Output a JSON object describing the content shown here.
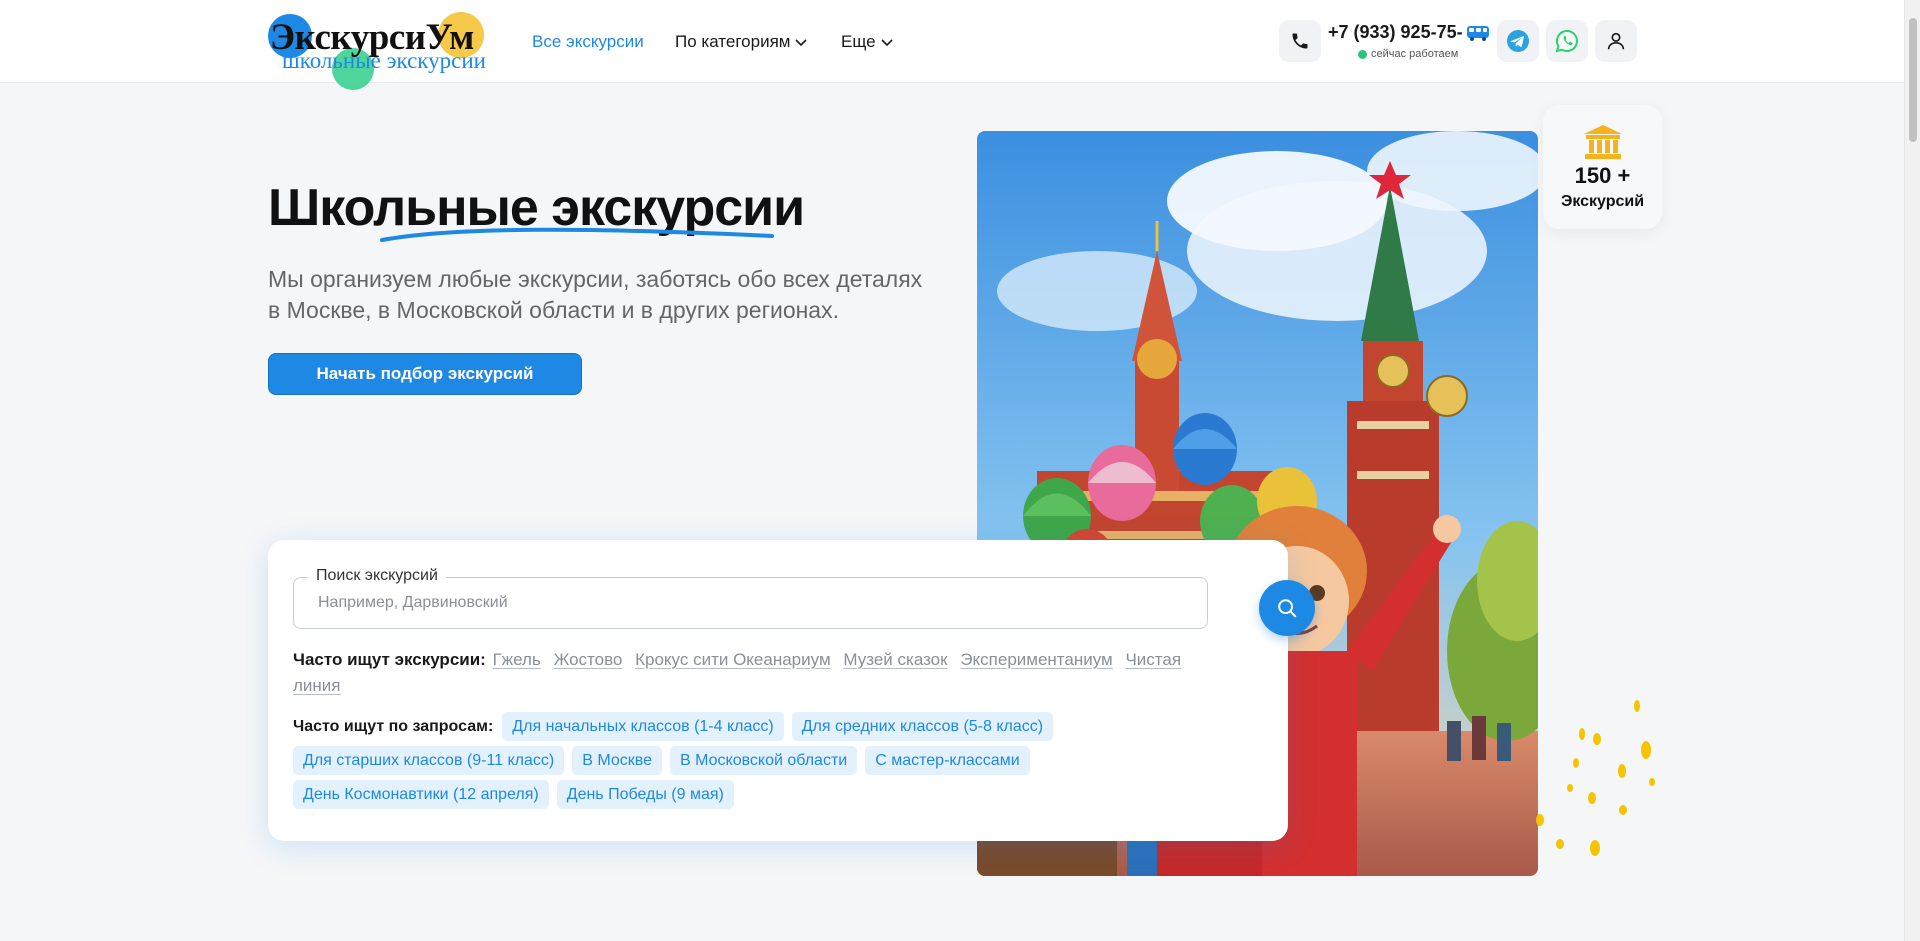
{
  "header": {
    "logo": {
      "title": "ЭкскурсиУм",
      "subtitle": "школьные экскурсии"
    },
    "nav": [
      {
        "label": "Все экскурсии",
        "active": true,
        "dropdown": false
      },
      {
        "label": "По категориям",
        "active": false,
        "dropdown": true
      },
      {
        "label": "Еще",
        "active": false,
        "dropdown": true
      }
    ],
    "phone": {
      "number": "+7 (933) 925-75-",
      "status": "сейчас работаем",
      "status_color": "#2ec27e"
    },
    "icons": [
      "phone-icon",
      "bus-icon",
      "telegram-icon",
      "whatsapp-icon",
      "user-icon"
    ]
  },
  "hero": {
    "title": "Школьные экскурсии",
    "description": "Мы организуем любые экскурсии, заботясь обо всех деталях в Москве, в Московской области и в других регионах.",
    "cta_label": "Начать подбор экскурсий"
  },
  "badge": {
    "value": "150 +",
    "label": "Экскурсий",
    "icon": "museum-icon"
  },
  "search": {
    "label": "Поиск экскурсий",
    "placeholder": "Например, Дарвиновский",
    "popular_lead": "Часто ищут экскурсии:",
    "popular_links": [
      "Гжель",
      "Жостово",
      "Крокус сити Океанариум",
      "Музей сказок",
      "Экспериментаниум",
      "Чистая линия"
    ],
    "queries_lead": "Часто ищут по запросам:",
    "query_chips": [
      [
        "Для начальных классов (1-4 класс)",
        "Для средних классов (5-8 класс)"
      ],
      [
        "Для старших классов (9-11 класс)",
        "В Москве",
        "В Московской области",
        "С мастер-классами"
      ],
      [
        "День Космонавтики (12 апреля)",
        "День Победы (9 мая)"
      ]
    ]
  },
  "colors": {
    "accent": "#1e88e5",
    "chip_bg": "#e3f1fc",
    "page_bg": "#f5f6f8"
  }
}
